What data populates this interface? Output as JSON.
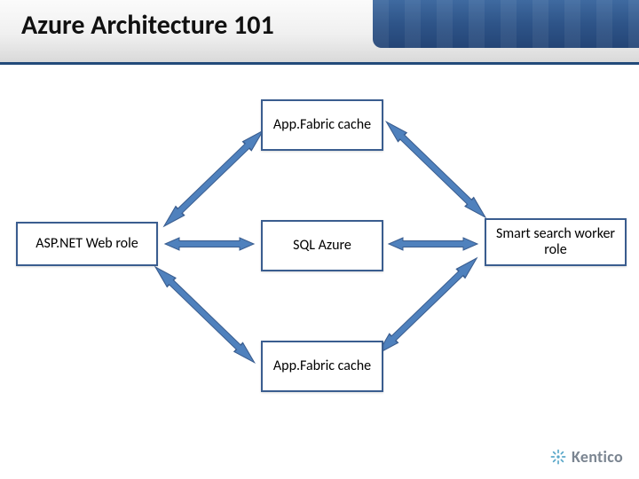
{
  "title": "Azure Architecture 101",
  "nodes": {
    "left": "ASP.NET Web role",
    "right": "Smart search worker role",
    "top": "App.Fabric cache",
    "middle": "SQL Azure",
    "bottom": "App.Fabric cache"
  },
  "brand": "Kentico",
  "colors": {
    "node_border": "#3a5d8f",
    "arrow_fill": "#4f81bd",
    "title_bar": "#224a7a"
  }
}
